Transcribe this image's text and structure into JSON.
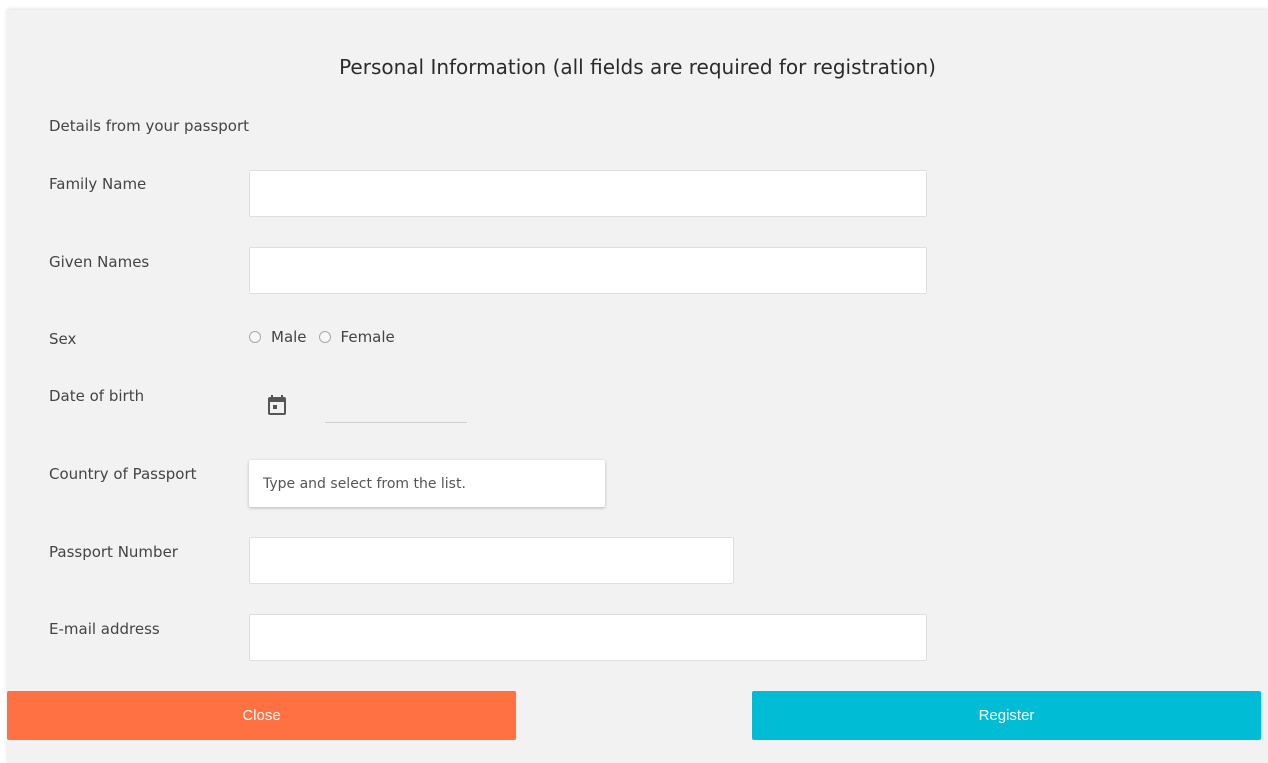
{
  "form": {
    "title": "Personal Information (all fields are required for registration)",
    "subtitle": "Details from your passport",
    "family_name_label": "Family Name",
    "family_name_value": "",
    "given_names_label": "Given Names",
    "given_names_value": "",
    "sex_label": "Sex",
    "sex_options": [
      "Male",
      "Female"
    ],
    "dob_label": "Date of birth",
    "dob_value": "",
    "country_label": "Country of Passport",
    "country_placeholder": "Type and select from the list.",
    "passport_label": "Passport Number",
    "passport_value": "",
    "email_label": "E-mail address",
    "email_value": ""
  },
  "buttons": {
    "close_label": "Close",
    "register_label": "Register"
  },
  "colors": {
    "close": "#ff7043",
    "register": "#00bcd4",
    "panel_bg": "#f2f2f2"
  },
  "icons": {
    "date_picker": "calendar-icon"
  }
}
